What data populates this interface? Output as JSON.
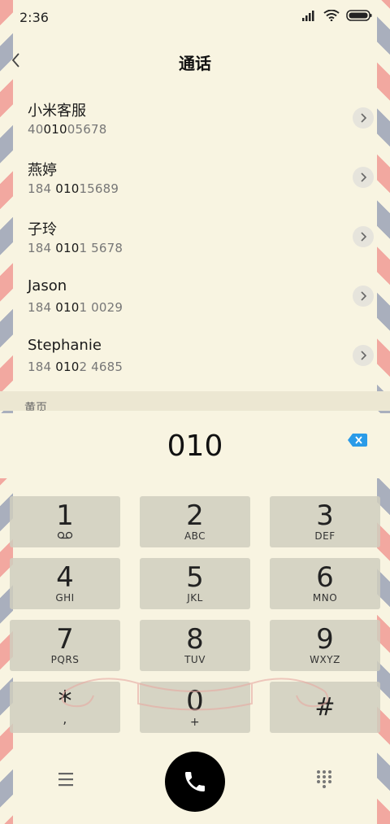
{
  "status_bar": {
    "time": "2:36"
  },
  "header": {
    "title": "通话"
  },
  "contacts": [
    {
      "name": "小米客服",
      "number_pre": "40",
      "number_match": "010",
      "number_post": "05678"
    },
    {
      "name": "燕婷",
      "number_pre": "184 ",
      "number_match": "010",
      "number_post": "15689"
    },
    {
      "name": "子玲",
      "number_pre": "184 ",
      "number_match": "010",
      "number_post": "1 5678"
    },
    {
      "name": "Jason",
      "number_pre": "184 ",
      "number_match": "010",
      "number_post": "1 0029"
    },
    {
      "name": "Stephanie",
      "number_pre": "184 ",
      "number_match": "010",
      "number_post": "2 4685"
    }
  ],
  "section": {
    "label": "黄页"
  },
  "dialer": {
    "input": "010"
  },
  "keypad": [
    {
      "digit": "1",
      "letters": ""
    },
    {
      "digit": "2",
      "letters": "ABC"
    },
    {
      "digit": "3",
      "letters": "DEF"
    },
    {
      "digit": "4",
      "letters": "GHI"
    },
    {
      "digit": "5",
      "letters": "JKL"
    },
    {
      "digit": "6",
      "letters": "MNO"
    },
    {
      "digit": "7",
      "letters": "PQRS"
    },
    {
      "digit": "8",
      "letters": "TUV"
    },
    {
      "digit": "9",
      "letters": "WXYZ"
    },
    {
      "digit": "*",
      "letters": ","
    },
    {
      "digit": "0",
      "letters": "+"
    },
    {
      "digit": "#",
      "letters": ""
    }
  ],
  "icons": {
    "signal": "signal-icon",
    "wifi": "wifi-icon",
    "battery": "battery-icon",
    "back": "back-icon",
    "chevron": "chevron-right-icon",
    "backspace": "backspace-icon",
    "voicemail": "voicemail-icon",
    "menu": "menu-icon",
    "phone": "phone-icon",
    "dialpad": "dialpad-icon"
  },
  "colors": {
    "background": "#f8f4e1",
    "accent": "#2a9be8",
    "call_button": "#000000"
  }
}
